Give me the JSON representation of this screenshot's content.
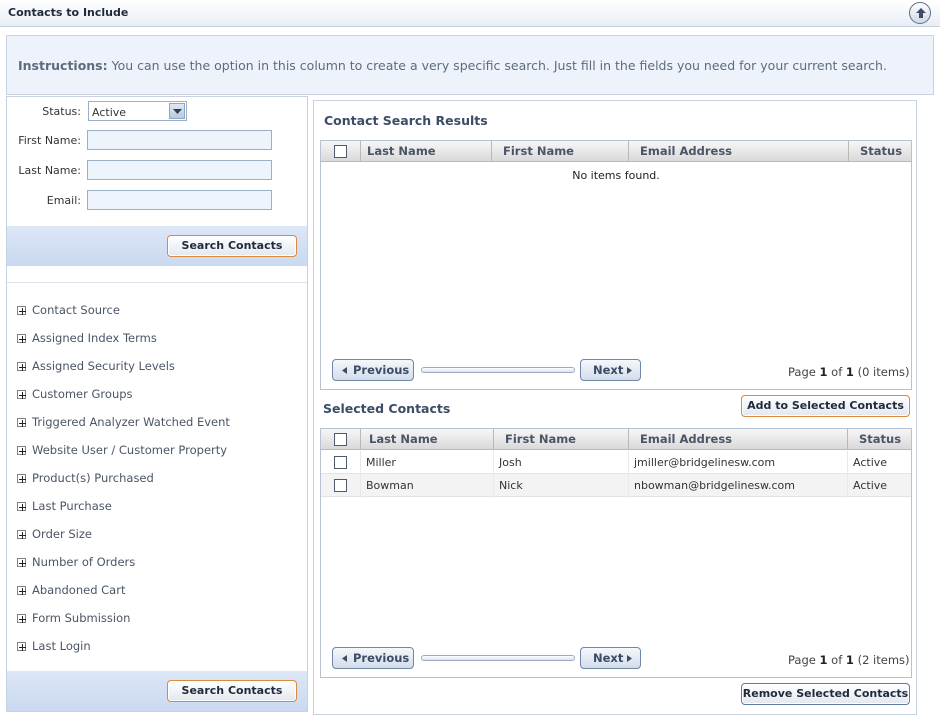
{
  "window": {
    "title": "Contacts to Include"
  },
  "instructions": {
    "label": "Instructions:",
    "text": "You can use the option in this column to create a very specific search. Just fill in the fields you need for your current search."
  },
  "filters": {
    "status_label": "Status:",
    "status_value": "Active",
    "first_name_label": "First Name:",
    "last_name_label": "Last Name:",
    "email_label": "Email:",
    "search_button": "Search Contacts"
  },
  "criteria": [
    "Contact Source",
    "Assigned Index Terms",
    "Assigned Security Levels",
    "Customer Groups",
    "Triggered Analyzer Watched Event",
    "Website User / Customer Property",
    "Product(s) Purchased",
    "Last Purchase",
    "Order Size",
    "Number of Orders",
    "Abandoned Cart",
    "Form Submission",
    "Last Login"
  ],
  "bottom_search_button": "Search Contacts",
  "columns": [
    "Last Name",
    "First Name",
    "Email Address",
    "Status"
  ],
  "search_results": {
    "title": "Contact Search Results",
    "empty_text": "No items found.",
    "pager": {
      "prev": "Previous",
      "next": "Next",
      "page_word": "Page",
      "page": "1",
      "of_word": "of",
      "total": "1",
      "items": "(0 items)"
    }
  },
  "selected": {
    "title": "Selected Contacts",
    "add_button": "Add to Selected Contacts",
    "rows": [
      {
        "last": "Miller",
        "first": "Josh",
        "email": "jmiller@bridgelinesw.com",
        "status": "Active"
      },
      {
        "last": "Bowman",
        "first": "Nick",
        "email": "nbowman@bridgelinesw.com",
        "status": "Active"
      }
    ],
    "pager": {
      "prev": "Previous",
      "next": "Next",
      "page_word": "Page",
      "page": "1",
      "of_word": "of",
      "total": "1",
      "items": "(2 items)"
    },
    "remove_button": "Remove Selected Contacts"
  },
  "icons": {
    "collapse": "collapse-up-icon",
    "expand": "plus-expand-icon"
  },
  "colors": {
    "accent_border": "#d98a3f",
    "header_text": "#3b4d66",
    "band": "#c9d9f0"
  }
}
